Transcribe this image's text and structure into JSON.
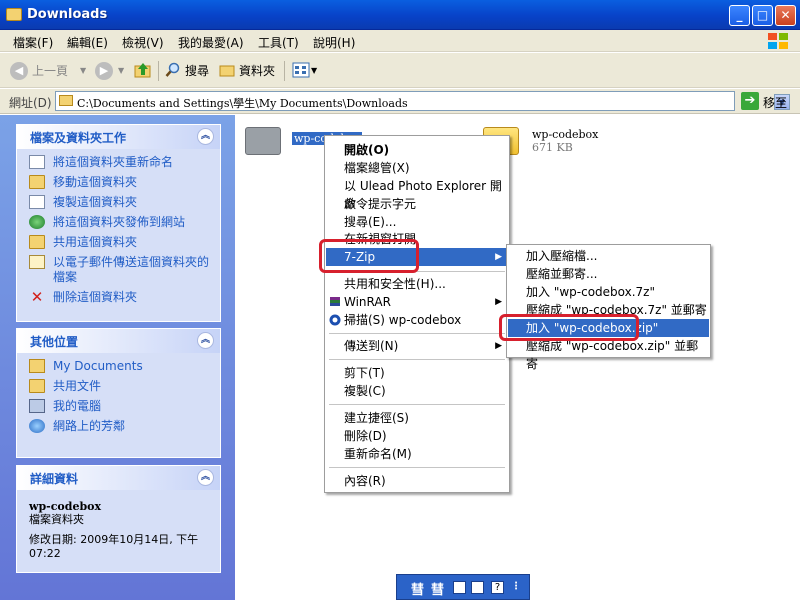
{
  "window": {
    "title": "Downloads"
  },
  "menubar": [
    "檔案(F)",
    "編輯(E)",
    "檢視(V)",
    "我的最愛(A)",
    "工具(T)",
    "說明(H)"
  ],
  "toolbar": {
    "back": "上一頁",
    "search": "搜尋",
    "folders": "資料夾"
  },
  "address": {
    "label": "網址(D)",
    "path": "C:\\Documents and Settings\\學生\\My Documents\\Downloads",
    "go": "移至"
  },
  "tasks": {
    "title": "檔案及資料夾工作",
    "items": [
      "將這個資料夾重新命名",
      "移動這個資料夾",
      "複製這個資料夾",
      "將這個資料夾發佈到網站",
      "共用這個資料夾",
      "以電子郵件傳送這個資料夾的檔案",
      "刪除這個資料夾"
    ]
  },
  "places": {
    "title": "其他位置",
    "items": [
      "My Documents",
      "共用文件",
      "我的電腦",
      "網路上的芳鄰"
    ]
  },
  "details": {
    "title": "詳細資料",
    "name": "wp-codebox",
    "type": "檔案資料夾",
    "modified": "修改日期: 2009年10月14日, 下午 07:22"
  },
  "files": [
    {
      "name": "wp-codebox",
      "selected": true
    },
    {
      "name": "wp-codebox",
      "size": "671 KB"
    }
  ],
  "context_menu": {
    "open": "開啟(O)",
    "explore": "檔案總管(X)",
    "ulead": "以 Ulead Photo Explorer 開啟",
    "cmd": "命令提示字元",
    "search": "搜尋(E)...",
    "newwin": "在新視窗打開",
    "sevenzip": "7-Zip",
    "share": "共用和安全性(H)...",
    "winrar": "WinRAR",
    "scan": "掃描(S) wp-codebox",
    "sendto": "傳送到(N)",
    "cut": "剪下(T)",
    "copy": "複製(C)",
    "shortcut": "建立捷徑(S)",
    "delete": "刪除(D)",
    "rename": "重新命名(M)",
    "props": "內容(R)"
  },
  "submenu": [
    "加入壓縮檔...",
    "壓縮並郵寄...",
    "加入 \"wp-codebox.7z\"",
    "壓縮成 \"wp-codebox.7z\" 並郵寄",
    "加入 \"wp-codebox.zip\"",
    "壓縮成 \"wp-codebox.zip\" 並郵寄"
  ],
  "ime": [
    "彗",
    "彗"
  ]
}
